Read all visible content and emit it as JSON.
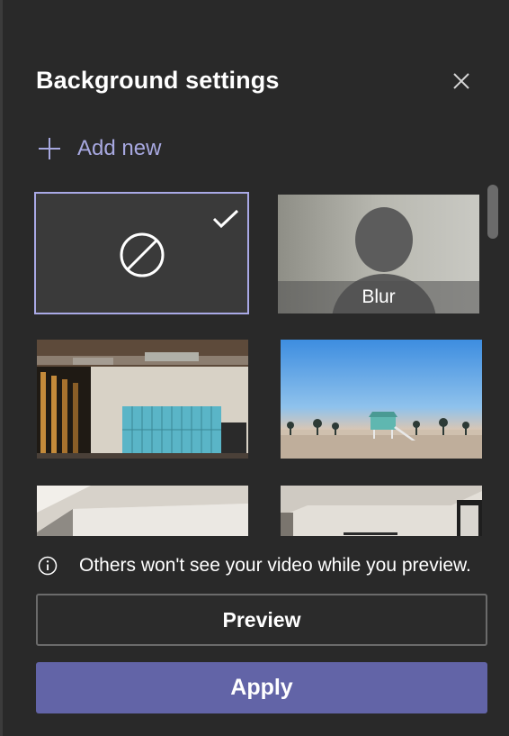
{
  "header": {
    "title": "Background settings",
    "close_icon": "close-icon"
  },
  "add_new": {
    "label": "Add new",
    "icon": "plus-icon"
  },
  "backgrounds": {
    "items": [
      {
        "id": "none",
        "icon": "no-background-icon",
        "selected": true,
        "selected_icon": "checkmark-icon"
      },
      {
        "id": "blur",
        "label": "Blur",
        "selected": false
      },
      {
        "id": "office-lockers",
        "selected": false
      },
      {
        "id": "beach-lifeguard",
        "selected": false
      },
      {
        "id": "room-ceiling-1",
        "selected": false
      },
      {
        "id": "room-ceiling-2",
        "selected": false
      }
    ]
  },
  "notice": {
    "icon": "info-icon",
    "text": "Others won't see your video while you preview."
  },
  "actions": {
    "preview_label": "Preview",
    "apply_label": "Apply"
  },
  "colors": {
    "accent": "#6264a7",
    "accent_light": "#a7a8e0",
    "panel_bg": "#292929"
  }
}
